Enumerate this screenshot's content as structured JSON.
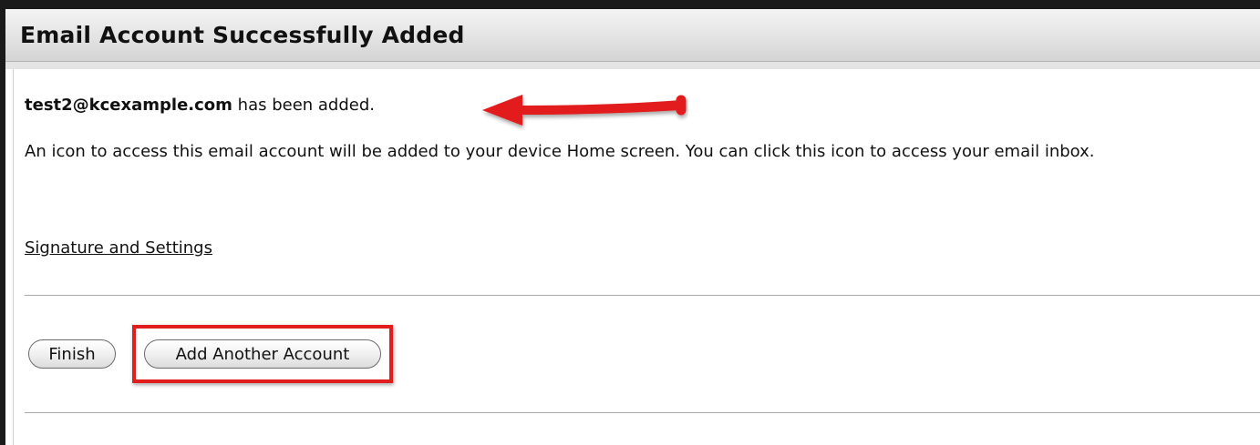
{
  "dialog": {
    "title": "Email Account Successfully Added"
  },
  "confirmation": {
    "email": "test2@kcexample.com",
    "suffix": "has been added."
  },
  "info_text": "An icon to access this email account will be added to your device Home screen. You can click this icon to access your email inbox.",
  "links": {
    "signature_settings": "Signature and Settings"
  },
  "buttons": {
    "finish": "Finish",
    "add_another": "Add Another Account"
  },
  "annotations": {
    "arrow_color": "#e21d1d",
    "highlight_color": "#e21d1d"
  }
}
